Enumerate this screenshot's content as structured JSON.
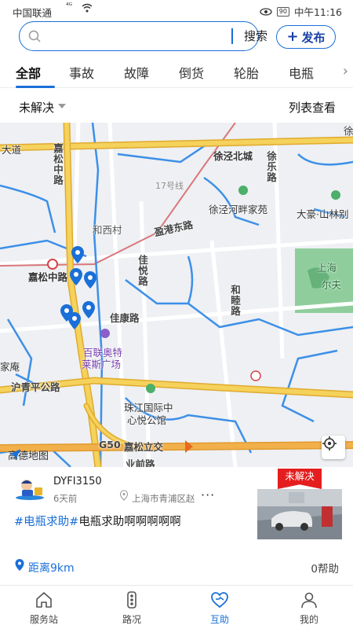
{
  "status_bar": {
    "carrier": "中国联通",
    "signal": "⁴ᴳ",
    "battery": "90",
    "time": "中午11:16"
  },
  "search": {
    "placeholder": "",
    "value": "",
    "button_label": "搜索",
    "publish_label": "发布"
  },
  "tabs": [
    "全部",
    "事故",
    "故障",
    "倒货",
    "轮胎",
    "电瓶"
  ],
  "active_tab": "全部",
  "filter": {
    "status_label": "未解决",
    "list_view_label": "列表查看"
  },
  "map": {
    "labels": {
      "daodao": "大道",
      "jiasong_zhonglu_v": "嘉松中路",
      "xujing_beicheng": "徐泾北城",
      "xule_road": "徐乐路",
      "line17": "17号线",
      "xujing_hepan": "徐泾河畔家苑",
      "dahao": "大豪·山林别",
      "hexi_village": "和西村",
      "yinggang_east": "盈港东路",
      "jiayue_road": "佳悦路",
      "shanghai_er": "上海",
      "erfu": "尔夫",
      "hemu_road": "和睦路",
      "jiasong_zhonglu": "嘉松中路",
      "jiakang_road": "佳康路",
      "bailian": "百联奥特",
      "bailian2": "莱斯广场",
      "jiaan": "家庵",
      "huqingping": "沪青平公路",
      "zhujiang": "珠江国际中",
      "zhujiang2": "心悦公馆",
      "g50": "G50",
      "jiasong_lijiao": "嘉松立交",
      "yeqian": "业前路",
      "xu_corner": "徐"
    },
    "logo": "高德地图"
  },
  "card": {
    "username": "DYFI3150",
    "time_ago": "6天前",
    "location": "上海市青浦区赵",
    "more": "···",
    "tag": "#电瓶求助#",
    "description": "电瓶求助啊啊啊啊啊",
    "badge": "未解决",
    "distance": "距离9km",
    "help_count": "0帮助"
  },
  "bottom_nav": [
    {
      "label": "服务站",
      "icon": "home-icon"
    },
    {
      "label": "路况",
      "icon": "traffic-light-icon"
    },
    {
      "label": "互助",
      "icon": "heart-handshake-icon"
    },
    {
      "label": "我的",
      "icon": "user-icon"
    }
  ],
  "active_nav": "互助",
  "colors": {
    "accent": "#1a6fd8",
    "highway": "#f2c84b",
    "water": "#3c8fe8",
    "badge": "#e41e1e",
    "park": "#4caf6a"
  }
}
